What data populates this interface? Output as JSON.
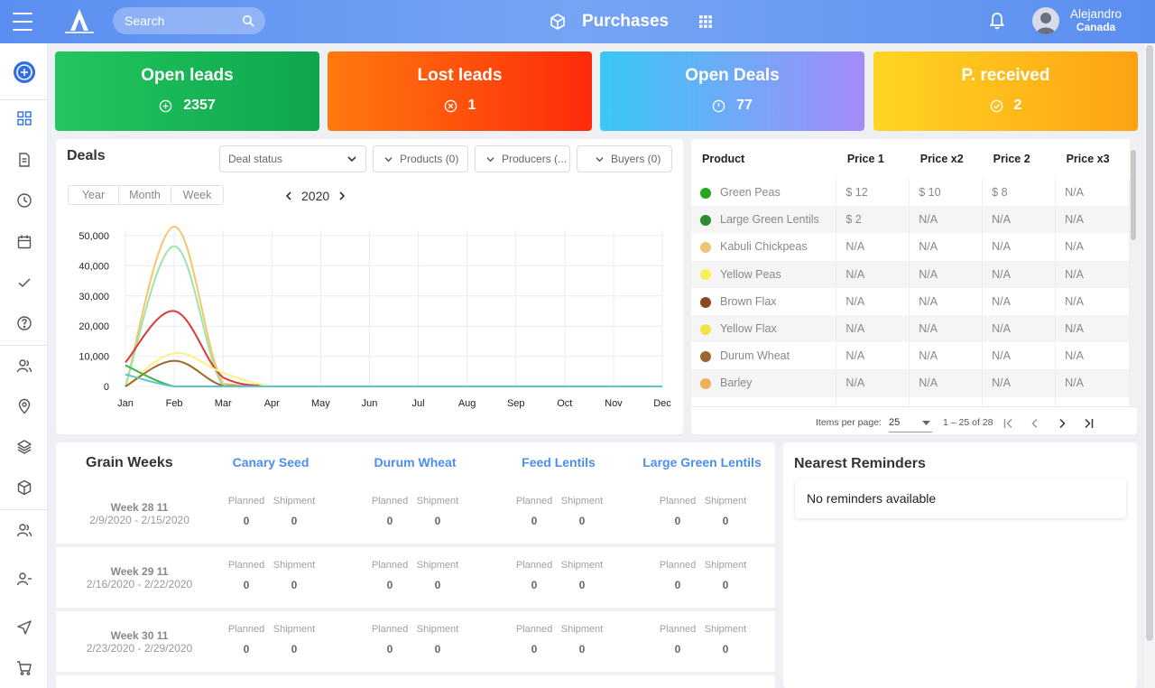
{
  "header": {
    "search_placeholder": "Search",
    "title": "Purchases",
    "user_name": "Alejandro",
    "user_location": "Canada"
  },
  "kpis": [
    {
      "title": "Open leads",
      "value": "2357",
      "icon": "plus-circle-icon",
      "color": "#1fbf5c"
    },
    {
      "title": "Lost leads",
      "value": "1",
      "icon": "x-circle-icon",
      "color": "#ff5a16"
    },
    {
      "title": "Open Deals",
      "value": "77",
      "icon": "clock-circle-icon",
      "color": "#5fb6f8"
    },
    {
      "title": "P. received",
      "value": "2",
      "icon": "check-circle-icon",
      "color": "#ffb91a"
    }
  ],
  "deals": {
    "title": "Deals",
    "filters": {
      "status": "Deal status",
      "products": "Products (0)",
      "producers": "Producers (...",
      "buyers": "Buyers (0)"
    },
    "periods": [
      "Year",
      "Month",
      "Week"
    ],
    "year": "2020"
  },
  "chart_data": {
    "type": "line",
    "x": [
      "Jan",
      "Feb",
      "Mar",
      "Apr",
      "May",
      "Jun",
      "Jul",
      "Aug",
      "Sep",
      "Oct",
      "Nov",
      "Dec"
    ],
    "yticks": [
      "50,000",
      "40,000",
      "30,000",
      "20,000",
      "10,000",
      "0"
    ],
    "ylim": [
      0,
      50000
    ],
    "grid": true,
    "series": [
      {
        "color": "#f4c667",
        "values": [
          0,
          53000,
          1000,
          0,
          0,
          0,
          0,
          0,
          0,
          0,
          0,
          0
        ]
      },
      {
        "color": "#9fe3a9",
        "values": [
          0,
          46500,
          0,
          0,
          0,
          0,
          0,
          0,
          0,
          0,
          0,
          0
        ]
      },
      {
        "color": "#dd3b3b",
        "values": [
          8000,
          25000,
          3000,
          0,
          0,
          0,
          0,
          0,
          0,
          0,
          0,
          0
        ]
      },
      {
        "color": "#fff083",
        "values": [
          0,
          11000,
          4500,
          0,
          0,
          0,
          0,
          0,
          0,
          0,
          0,
          0
        ]
      },
      {
        "color": "#a0652d",
        "values": [
          0,
          8500,
          200,
          0,
          0,
          0,
          0,
          0,
          0,
          0,
          0,
          0
        ]
      },
      {
        "color": "#3eb24a",
        "values": [
          7000,
          0,
          0,
          0,
          0,
          0,
          0,
          0,
          0,
          0,
          0,
          0
        ]
      },
      {
        "color": "#5cc5d0",
        "values": [
          4000,
          0,
          0,
          0,
          0,
          0,
          0,
          0,
          0,
          0,
          0,
          0
        ]
      }
    ]
  },
  "prices": {
    "columns": [
      "Product",
      "Price 1",
      "Price x2",
      "Price 2",
      "Price x3"
    ],
    "rows": [
      {
        "name": "Green Peas",
        "p1": "$ 12",
        "px2": "$ 10",
        "p2": "$ 8",
        "px3": "N/A",
        "color": "#22a61f"
      },
      {
        "name": "Large Green Lentils",
        "p1": "$ 2",
        "px2": "N/A",
        "p2": "N/A",
        "px3": "N/A",
        "color": "#2e8b2e"
      },
      {
        "name": "Kabuli Chickpeas",
        "p1": "N/A",
        "px2": "N/A",
        "p2": "N/A",
        "px3": "N/A",
        "color": "#efc473"
      },
      {
        "name": "Yellow Peas",
        "p1": "N/A",
        "px2": "N/A",
        "p2": "N/A",
        "px3": "N/A",
        "color": "#f7f05b"
      },
      {
        "name": "Brown Flax",
        "p1": "N/A",
        "px2": "N/A",
        "p2": "N/A",
        "px3": "N/A",
        "color": "#8a4a1f"
      },
      {
        "name": "Yellow Flax",
        "p1": "N/A",
        "px2": "N/A",
        "p2": "N/A",
        "px3": "N/A",
        "color": "#f3e34a"
      },
      {
        "name": "Durum Wheat",
        "p1": "N/A",
        "px2": "N/A",
        "p2": "N/A",
        "px3": "N/A",
        "color": "#a0652d"
      },
      {
        "name": "Barley",
        "p1": "N/A",
        "px2": "N/A",
        "p2": "N/A",
        "px3": "N/A",
        "color": "#f0b05a"
      }
    ],
    "items_per_page_label": "Items per page:",
    "items_per_page": "25",
    "range": "1 – 25 of 28"
  },
  "grain_weeks": {
    "title": "Grain Weeks",
    "products": [
      "Canary Seed",
      "Durum Wheat",
      "Feed Lentils",
      "Large Green Lentils"
    ],
    "planned_label": "Planned",
    "shipment_label": "Shipment",
    "weeks": [
      {
        "week": "Week 28 11",
        "dates": "2/9/2020 - 2/15/2020",
        "values": [
          "0",
          "0",
          "0",
          "0",
          "0",
          "0",
          "0",
          "0"
        ]
      },
      {
        "week": "Week 29 11",
        "dates": "2/16/2020 - 2/22/2020",
        "values": [
          "0",
          "0",
          "0",
          "0",
          "0",
          "0",
          "0",
          "0"
        ]
      },
      {
        "week": "Week 30 11",
        "dates": "2/23/2020 - 2/29/2020",
        "values": [
          "0",
          "0",
          "0",
          "0",
          "0",
          "0",
          "0",
          "0"
        ]
      }
    ]
  },
  "reminders": {
    "title": "Nearest Reminders",
    "empty": "No reminders available"
  }
}
